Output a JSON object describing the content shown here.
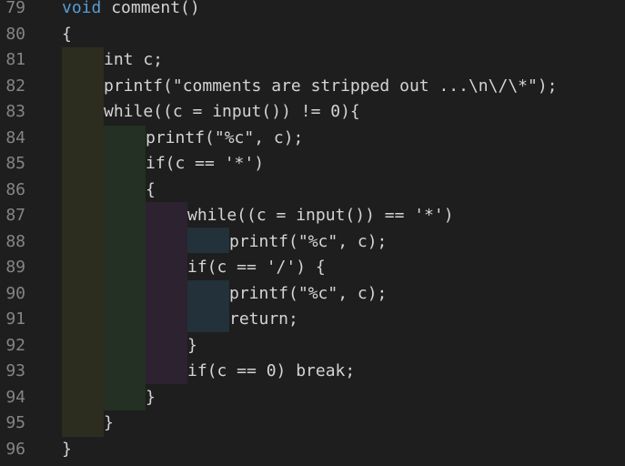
{
  "editor": {
    "theme_colors": {
      "background": "#1e1e1e",
      "text": "#d4d4d4",
      "line_number": "#858585",
      "keyword": "#569cd6",
      "indent_level_1": "#2c2c1f",
      "indent_level_2": "#233023",
      "indent_level_3": "#2d2230",
      "indent_level_4": "#22313a"
    },
    "lines": [
      {
        "num": "79",
        "text": "void comment()",
        "indent": 0
      },
      {
        "num": "80",
        "text": "{",
        "indent": 0
      },
      {
        "num": "81",
        "text": "int c;",
        "indent": 1
      },
      {
        "num": "82",
        "text": "printf(\"comments are stripped out ...\\n\\/\\*\");",
        "indent": 1
      },
      {
        "num": "83",
        "text": "while((c = input()) != 0){",
        "indent": 1
      },
      {
        "num": "84",
        "text": "printf(\"%c\", c);",
        "indent": 2
      },
      {
        "num": "85",
        "text": "if(c == '*')",
        "indent": 2
      },
      {
        "num": "86",
        "text": "{",
        "indent": 2
      },
      {
        "num": "87",
        "text": "while((c = input()) == '*')",
        "indent": 3
      },
      {
        "num": "88",
        "text": "printf(\"%c\", c);",
        "indent": 4
      },
      {
        "num": "89",
        "text": "if(c == '/') {",
        "indent": 3
      },
      {
        "num": "90",
        "text": "printf(\"%c\", c);",
        "indent": 4
      },
      {
        "num": "91",
        "text": "return;",
        "indent": 4
      },
      {
        "num": "92",
        "text": "}",
        "indent": 3
      },
      {
        "num": "93",
        "text": "if(c == 0) break;",
        "indent": 3
      },
      {
        "num": "94",
        "text": "}",
        "indent": 2
      },
      {
        "num": "95",
        "text": "}",
        "indent": 1
      },
      {
        "num": "96",
        "text": "}",
        "indent": 0
      }
    ]
  }
}
